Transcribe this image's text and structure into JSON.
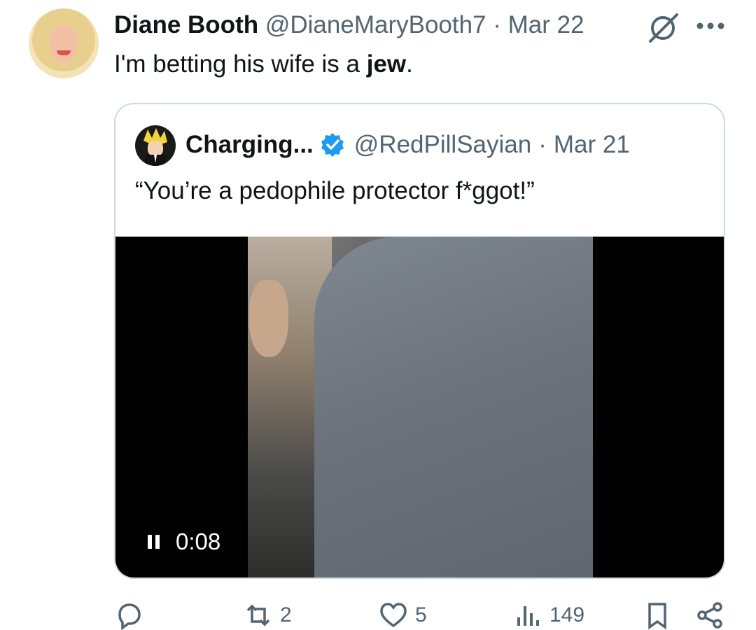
{
  "tweet": {
    "display_name": "Diane Booth",
    "handle": "@DianeMaryBooth7",
    "separator": "·",
    "date": "Mar 22",
    "text_prefix": "I'm betting his wife is a ",
    "text_bold": "jew",
    "text_suffix": "."
  },
  "quote": {
    "display_name": "Charging...",
    "handle": "@RedPillSayian",
    "separator": "·",
    "date": "Mar 21",
    "text": "“You’re a pedophile protector f*ggot!”",
    "video": {
      "timestamp": "0:08",
      "state": "playing"
    }
  },
  "actions": {
    "reply_count": "",
    "retweet_count": "2",
    "like_count": "5",
    "view_count": "149"
  },
  "icons": {
    "header": [
      "grok-icon",
      "more-icon"
    ],
    "quote": [
      "verified-icon"
    ],
    "video": [
      "pause-icon"
    ],
    "action_bar": [
      "reply-icon",
      "retweet-icon",
      "like-icon",
      "views-icon",
      "bookmark-icon",
      "share-icon"
    ]
  },
  "colors": {
    "verified_blue": "#1d9bf0",
    "secondary_text": "#536471",
    "border": "#cfd9de"
  }
}
